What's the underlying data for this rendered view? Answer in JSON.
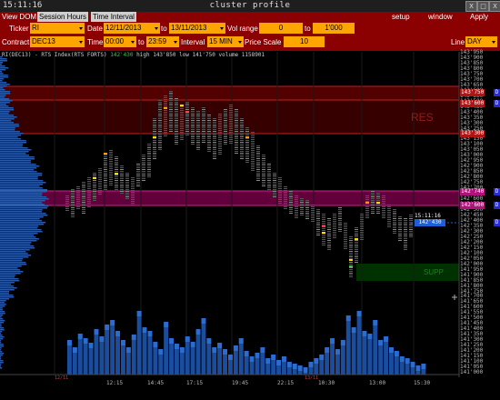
{
  "window": {
    "clock": "15:11:16",
    "title": "cluster profile",
    "buttons": [
      "X",
      "□",
      "X"
    ]
  },
  "menubar": {
    "tabs": [
      "View DOM",
      "Session Hours",
      "Time Interval"
    ],
    "menus": [
      "setup",
      "window",
      "Apply"
    ]
  },
  "toolbar": {
    "ticker_label": "Ticker",
    "ticker": "RI",
    "date_label": "Date",
    "date_from": "12/11/2013",
    "date_to_label": "to",
    "date_to": "13/11/2013",
    "vol_range_label": "Vol range",
    "vol_from": "0",
    "vol_to_label": "to",
    "vol_to": "1'000",
    "contract_label": "Contract",
    "contract": "DEC13",
    "time_label": "Time",
    "time_from": "00:00",
    "time_to_label": "to",
    "time_to": "23:59",
    "interval_label": "Interval",
    "interval": "15 MIN",
    "price_scale_label": "Price Scale",
    "price_scale": "10",
    "line_label": "Line",
    "line": "DAY"
  },
  "chart_info": {
    "symbol": "RI(DEC13) - RTS Index(RTS FORTS)",
    "last": "142'430",
    "high": "high 143'850",
    "low": "low 141'750",
    "volume": "volume 1158901"
  },
  "y_axis": {
    "labels": [
      "143'950",
      "143'900",
      "143'850",
      "143'800",
      "143'750",
      "143'700",
      "143'650",
      "143'600",
      "143'550",
      "143'500",
      "143'450",
      "143'400",
      "143'350",
      "143'300",
      "143'250",
      "143'200",
      "143'150",
      "143'100",
      "143'050",
      "143'000",
      "142'950",
      "142'900",
      "142'850",
      "142'800",
      "142'750",
      "142'700",
      "142'650",
      "142'600",
      "142'550",
      "142'500",
      "142'450",
      "142'400",
      "142'350",
      "142'300",
      "142'250",
      "142'200",
      "142'150",
      "142'100",
      "142'050",
      "142'000",
      "141'950",
      "141'900",
      "141'850",
      "141'800",
      "141'750",
      "141'700",
      "141'650",
      "141'600",
      "141'550",
      "141'500",
      "141'450",
      "141'400",
      "141'350",
      "141'300",
      "141'250",
      "141'200",
      "141'150",
      "141'100",
      "141'050",
      "141'000"
    ],
    "tags": [
      {
        "text": "143'750",
        "color": "#b01515"
      },
      {
        "text": "143'600",
        "color": "#b01515"
      },
      {
        "text": "143'300",
        "color": "#b01515"
      },
      {
        "text": "142'740",
        "color": "#b0117a"
      },
      {
        "text": "142'600",
        "color": "#b0117a"
      }
    ],
    "d_marker": "D"
  },
  "x_axis": {
    "labels": [
      "12:15",
      "14:45",
      "17:15",
      "19:45",
      "22:15",
      "10:30",
      "13:00",
      "15:30"
    ],
    "day_markers": [
      "12/11",
      "13/11"
    ]
  },
  "zones": {
    "resistance_label": "RES",
    "support_label": "SUPP"
  },
  "current": {
    "time": "15:11:16",
    "price": "142'430"
  }
}
